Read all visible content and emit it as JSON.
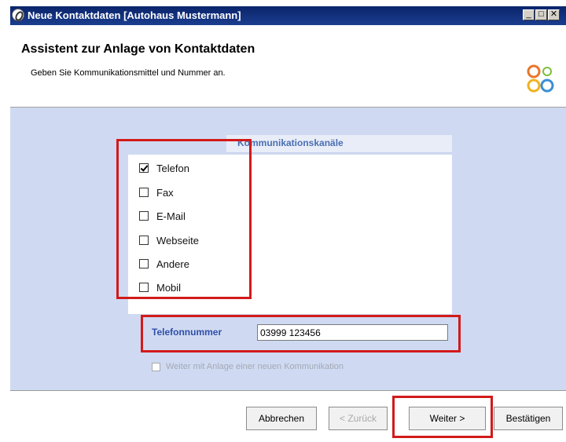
{
  "window": {
    "title": "Neue Kontaktdaten [Autohaus Mustermann]",
    "controls": [
      "minimize",
      "maximize",
      "close"
    ]
  },
  "header": {
    "title": "Assistent zur Anlage von Kontaktdaten",
    "subtitle": "Geben Sie Kommunikationsmittel und Nummer an."
  },
  "panel": {
    "title": "Kommunikationskanäle",
    "channels": [
      {
        "label": "Telefon",
        "checked": true
      },
      {
        "label": "Fax",
        "checked": false
      },
      {
        "label": "E-Mail",
        "checked": false
      },
      {
        "label": "Webseite",
        "checked": false
      },
      {
        "label": "Andere",
        "checked": false
      },
      {
        "label": "Mobil",
        "checked": false
      }
    ]
  },
  "phone": {
    "label": "Telefonnummer",
    "value": "03999 123456"
  },
  "continue_option": {
    "label": "Weiter mit Anlage einer neuen Kommunikation",
    "checked": false,
    "enabled": false
  },
  "buttons": {
    "cancel": "Abbrechen",
    "back": "< Zurück",
    "next": "Weiter >",
    "confirm": "Bestätigen"
  },
  "colors": {
    "titlebar": "#0a246a",
    "body": "#cfdaf2",
    "highlight": "#d21a1a",
    "label_blue": "#2f4ea8"
  },
  "icons": {
    "app": "app-icon",
    "logo": "brand-logo"
  }
}
